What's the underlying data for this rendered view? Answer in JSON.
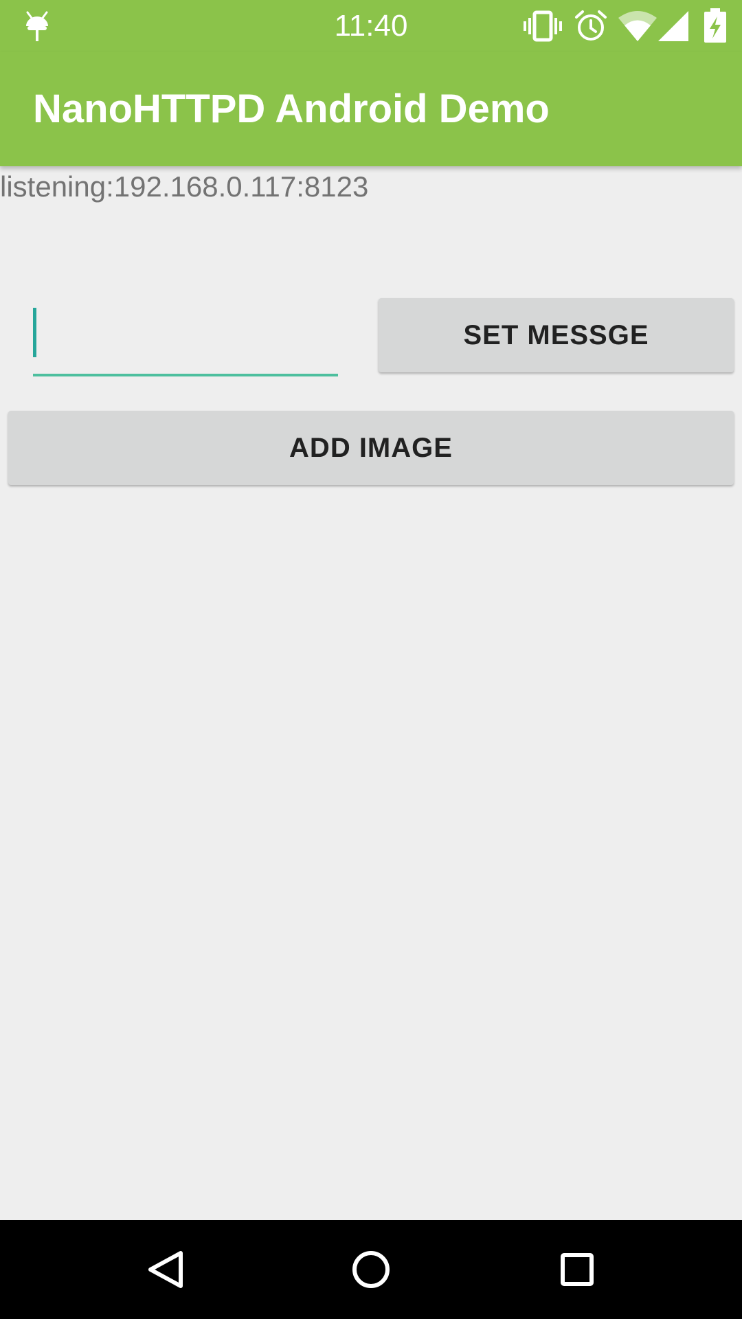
{
  "status_bar": {
    "time": "11:40",
    "icons": [
      "android-debug-icon",
      "vibrate-icon",
      "alarm-icon",
      "wifi-icon",
      "cell-signal-icon",
      "battery-charging-icon"
    ]
  },
  "app_bar": {
    "title": "NanoHTTPD Android Demo",
    "color": "#8bc34a"
  },
  "content": {
    "listening_text": "listening:192.168.0.117:8123",
    "message_input": {
      "value": "",
      "placeholder": ""
    },
    "set_message_button": "SET MESSGE",
    "add_image_button": "ADD IMAGE"
  },
  "nav_bar": {
    "icons": [
      "back-icon",
      "home-icon",
      "recents-icon"
    ]
  }
}
